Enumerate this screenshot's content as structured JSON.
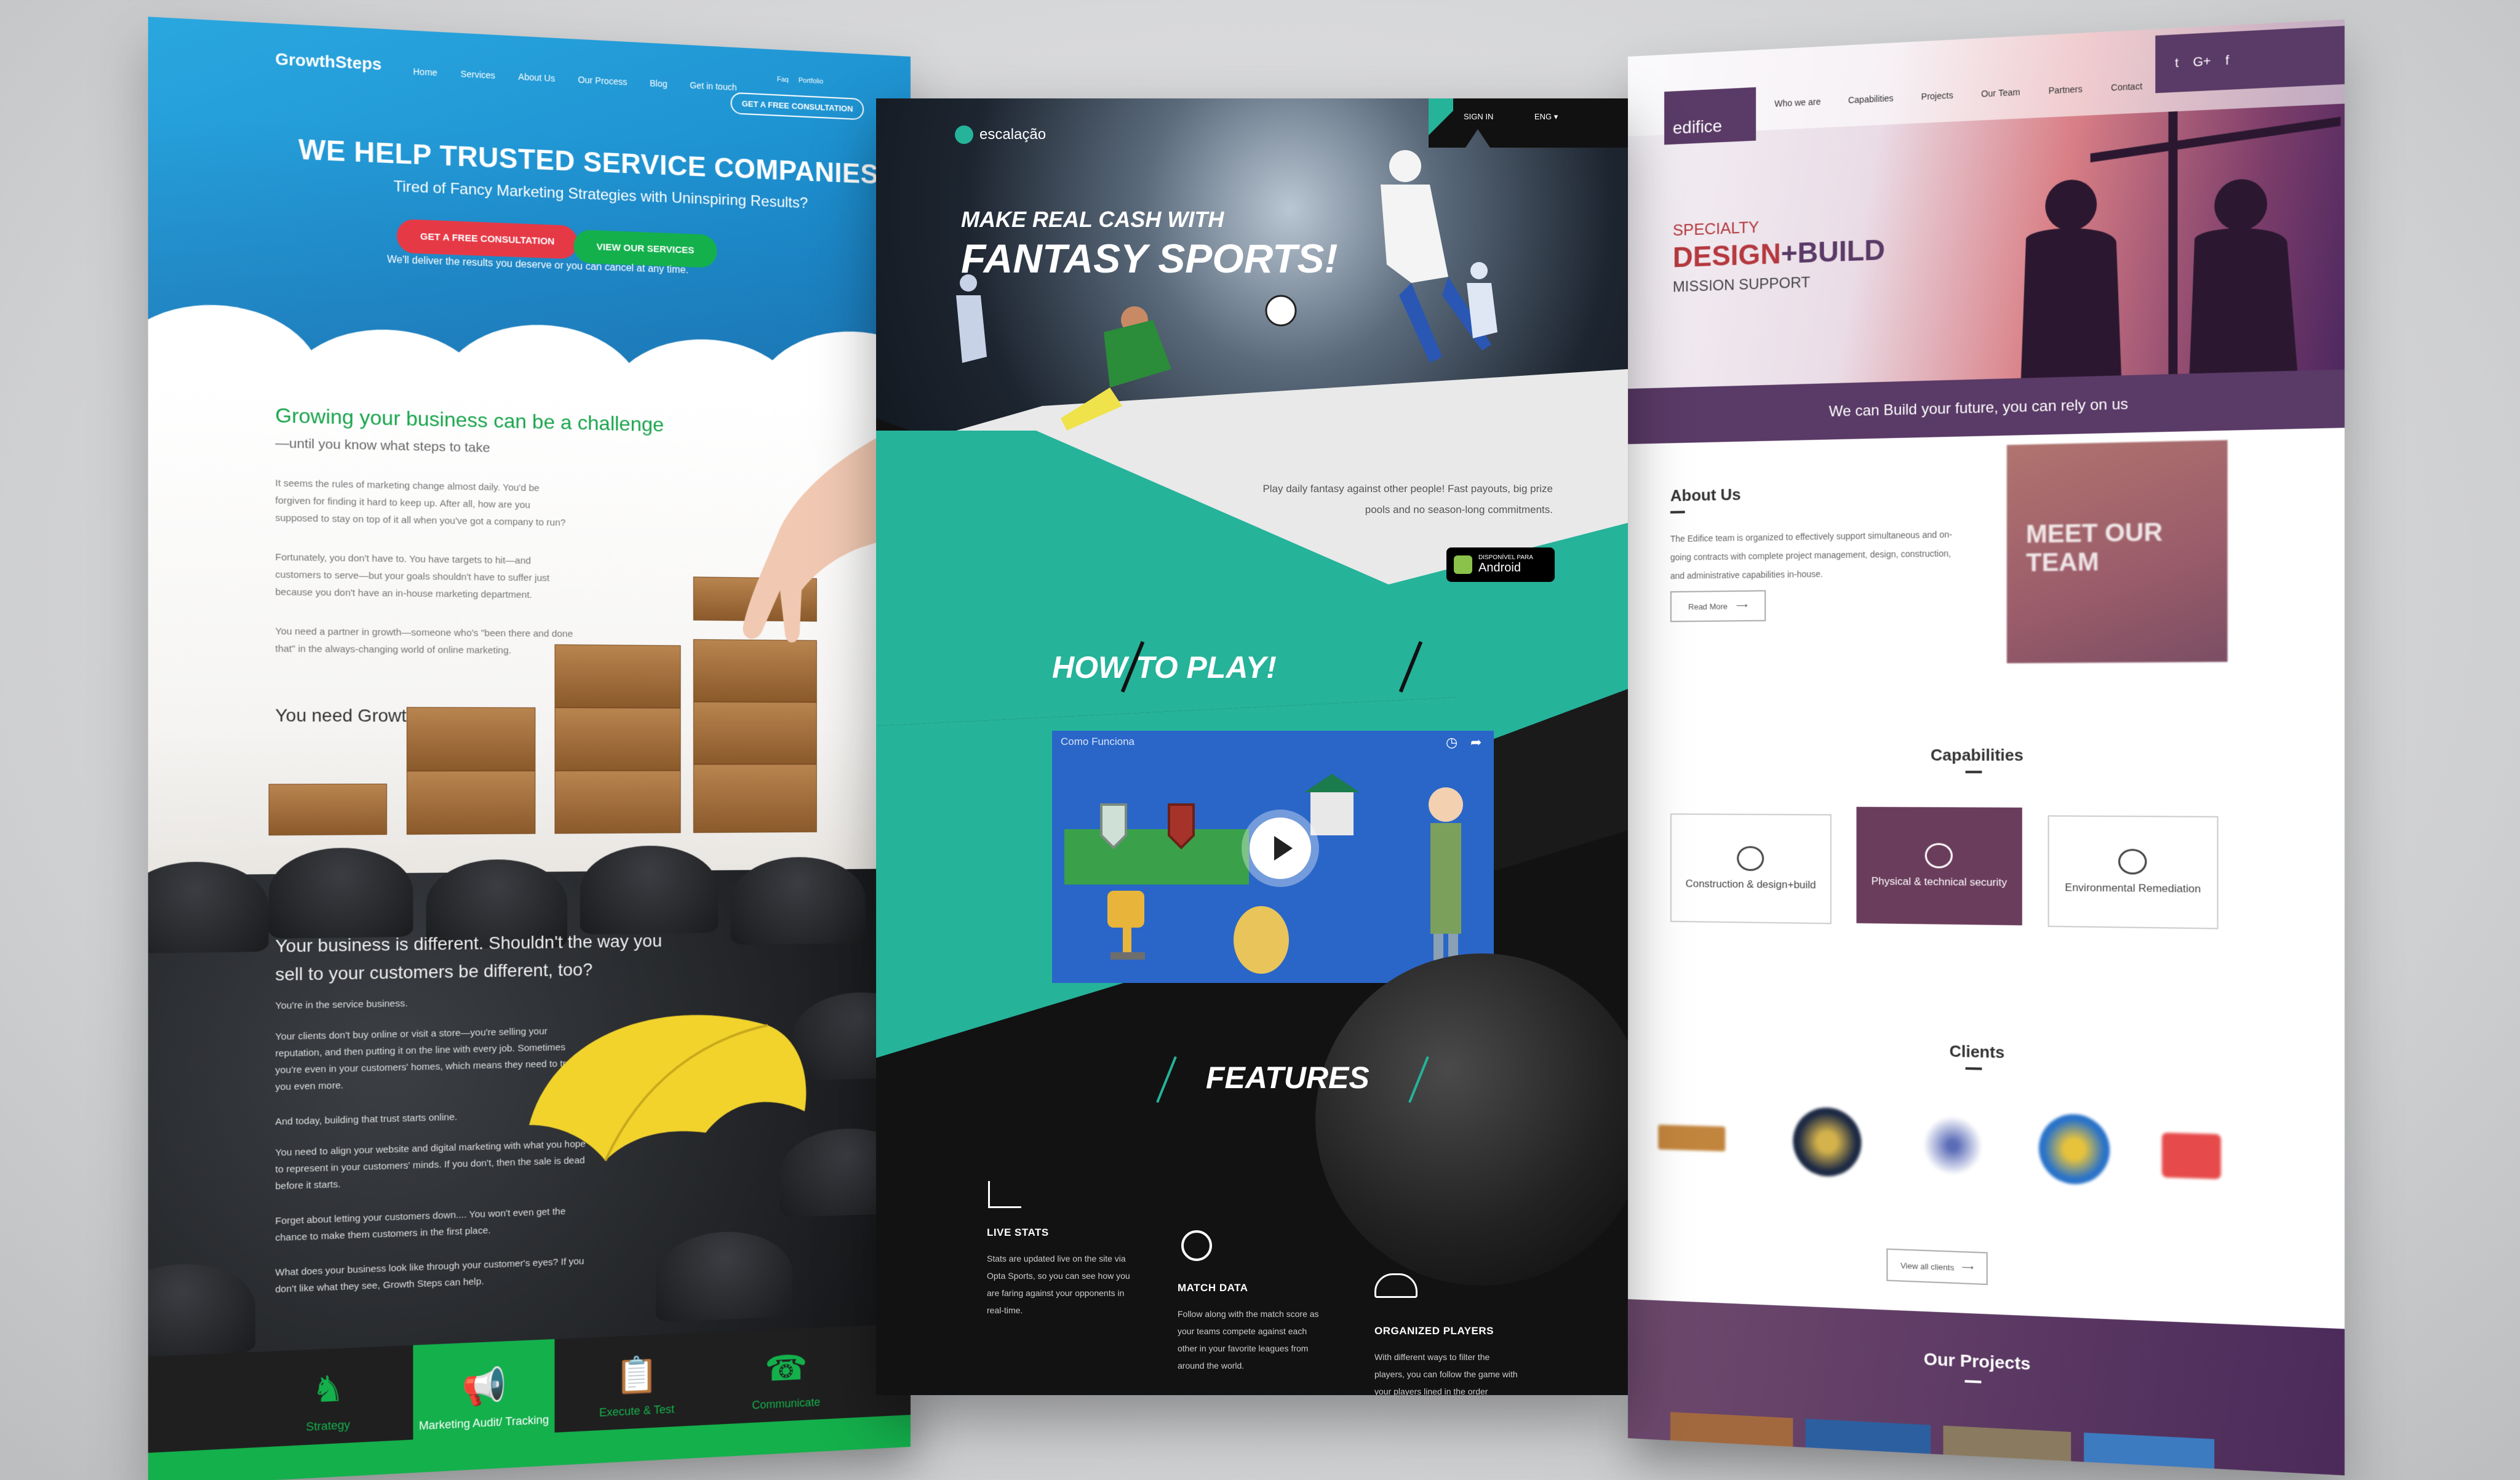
{
  "left": {
    "logo": "GrowthSteps",
    "top_links": [
      "Faq",
      "Portfolio"
    ],
    "nav": [
      "Home",
      "Services",
      "About Us",
      "Our Process",
      "Blog",
      "Get in touch"
    ],
    "nav_cta": "GET A FREE CONSULTATION",
    "headline": "WE HELP TRUSTED SERVICE COMPANIES GROW",
    "subheadline": "Tired of Fancy Marketing Strategies with Uninspiring Results?",
    "cta_primary": "GET A FREE CONSULTATION",
    "cta_secondary": "VIEW OUR SERVICES",
    "deliver": "We'll deliver the results you deserve or you can cancel at any time.",
    "challenge_title": "Growing your business can be a challenge",
    "challenge_sub": "—until you know what steps to take",
    "paragraphs": [
      "It seems the rules of marketing change almost daily. You'd be forgiven for finding it hard to keep up. After all, how are you supposed to stay on top of it all when you've got a company to run?",
      "Fortunately, you don't have to. You have targets to hit—and customers to serve—but your goals shouldn't have to suffer just because you don't have an in-house marketing department.",
      "You need a partner in growth—someone who's \"been there and done that\" in the always-changing world of online marketing."
    ],
    "need": "You need Growth Steps.",
    "dark_title": "Your business is different. Shouldn't the way you sell to your customers be different, too?",
    "dark_paragraphs": [
      "You're in the service business.",
      "Your clients don't buy online or visit a store—you're selling your reputation, and then putting it on the line with every job. Sometimes you're even in your customers' homes, which means they need to trust you even more.",
      "And today, building that trust starts online.",
      "You need to align your website and digital marketing with what you hope to represent in your customers' minds. If you don't, then the sale is dead before it starts.",
      "Forget about letting your customers down.... You won't even get the chance to make them customers in the first place.",
      "What does your business look like through your customer's eyes? If you don't like what they see, Growth Steps can help."
    ],
    "features": [
      {
        "label": "Strategy",
        "icon": "chess-knight-icon"
      },
      {
        "label": "Marketing Audit/ Tracking",
        "icon": "megaphone-icon"
      },
      {
        "label": "Execute & Test",
        "icon": "clipboard-icon"
      },
      {
        "label": "Communicate",
        "icon": "phone-icon"
      }
    ],
    "colors": {
      "primary": "#1c8fcf",
      "green": "#14b04c",
      "red": "#e63946"
    }
  },
  "center": {
    "logo": "escalação",
    "signin": "SIGN IN",
    "lang": "ENG ▾",
    "headline_1": "MAKE REAL CASH WITH",
    "headline_2": "FANTASY SPORTS!",
    "play_text": "Play daily fantasy against other people! Fast payouts, big prize pools and no season-long commitments.",
    "android_small": "DISPONÍVEL PARA",
    "android_big": "Android",
    "how_to_play": "HOW TO PLAY!",
    "video_title": "Como Funciona",
    "features_title": "FEATURES",
    "features": [
      {
        "title": "LIVE STATS",
        "text": "Stats are updated live on the site via Opta Sports, so you can see how you are faring against your opponents in real-time.",
        "icon": "bar-chart-icon"
      },
      {
        "title": "MATCH DATA",
        "text": "Follow along with the match score as your teams compete against each other in your favorite leagues from around the world.",
        "icon": "refresh-icon"
      },
      {
        "title": "ORGANIZED PLAYERS",
        "text": "With different ways to filter the players, you can follow the game with your players lined in the order",
        "icon": "people-icon"
      }
    ],
    "colors": {
      "teal": "#25b39a",
      "dark": "#111111"
    }
  },
  "right": {
    "logo": "edifice",
    "nav": [
      "Who we are",
      "Capabilities",
      "Projects",
      "Our Team",
      "Partners",
      "Contact"
    ],
    "social": [
      "t",
      "G+",
      "f"
    ],
    "specialty": "SPECIALTY",
    "design": "DESIGN",
    "build": "+BUILD",
    "mission": "MISSION SUPPORT",
    "band": "We can Build your future, you can rely on us",
    "about_title": "About Us",
    "about_text": "The Edifice team is organized to effectively support simultaneous and on-going contracts with complete project management, design, construction, and administrative capabilities in-house.",
    "read_more": "Read More",
    "meet_team": "MEET OUR TEAM",
    "capabilities_title": "Capabilities",
    "capabilities": [
      {
        "label": "Construction & design+build",
        "icon": "crane-icon"
      },
      {
        "label": "Physical & technical security",
        "icon": "shield-icon"
      },
      {
        "label": "Environmental Remediation",
        "icon": "leaf-icon"
      }
    ],
    "clients_title": "Clients",
    "view_all": "View all clients",
    "projects_title": "Our Projects",
    "colors": {
      "purple": "#5a3a66",
      "red": "#b4393f"
    }
  }
}
